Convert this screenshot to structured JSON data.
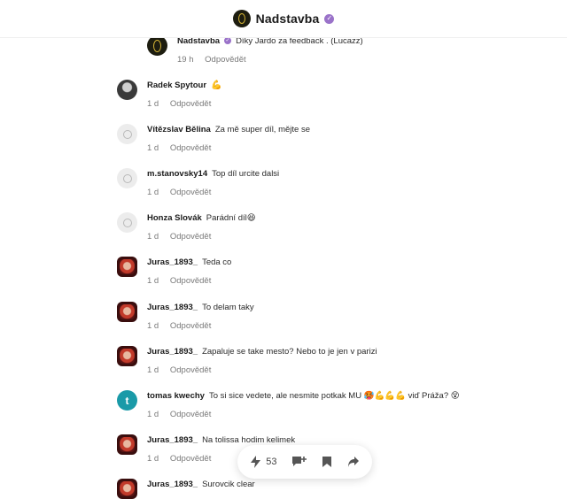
{
  "header": {
    "name": "Nadstavba"
  },
  "reply_label": "Odpovědět",
  "comments": [
    {
      "author": "Nadstavba",
      "verified": true,
      "text": "Díky Jardo za feedback . (Lucazz)",
      "time": "19 h",
      "avatar": "brand"
    },
    {
      "author": "Radek Spytour",
      "text": "💪",
      "time": "1 d",
      "avatar": "photo"
    },
    {
      "author": "Vítězslav Bělina",
      "text": "Za mě super díl, mějte se",
      "time": "1 d",
      "avatar": "default"
    },
    {
      "author": "m.stanovsky14",
      "text": "Top díl urcite dalsi",
      "time": "1 d",
      "avatar": "default"
    },
    {
      "author": "Honza Slovák",
      "text": "Parádní díl😆",
      "time": "1 d",
      "avatar": "default"
    },
    {
      "author": "Juras_1893_",
      "text": "Teda co",
      "time": "1 d",
      "avatar": "red"
    },
    {
      "author": "Juras_1893_",
      "text": "To delam taky",
      "time": "1 d",
      "avatar": "red"
    },
    {
      "author": "Juras_1893_",
      "text": "Zapaluje se take mesto? Nebo to je jen v parizi",
      "time": "1 d",
      "avatar": "red"
    },
    {
      "author": "tomas kwechy",
      "text": "To si sice vedete, ale nesmite potkak MU 🥵💪💪💪 viď Práža? 😵",
      "time": "1 d",
      "avatar": "teal",
      "initial": "t"
    },
    {
      "author": "Juras_1893_",
      "text": "Na tolissa hodim kelimek",
      "time": "1 d",
      "avatar": "red"
    },
    {
      "author": "Juras_1893_",
      "text": "Surovcik clear",
      "time": "1 d",
      "avatar": "red"
    }
  ],
  "action_bar": {
    "like_count": "53",
    "icons": [
      "lightning-like-icon",
      "comment-add-icon",
      "bookmark-icon",
      "share-icon"
    ]
  }
}
